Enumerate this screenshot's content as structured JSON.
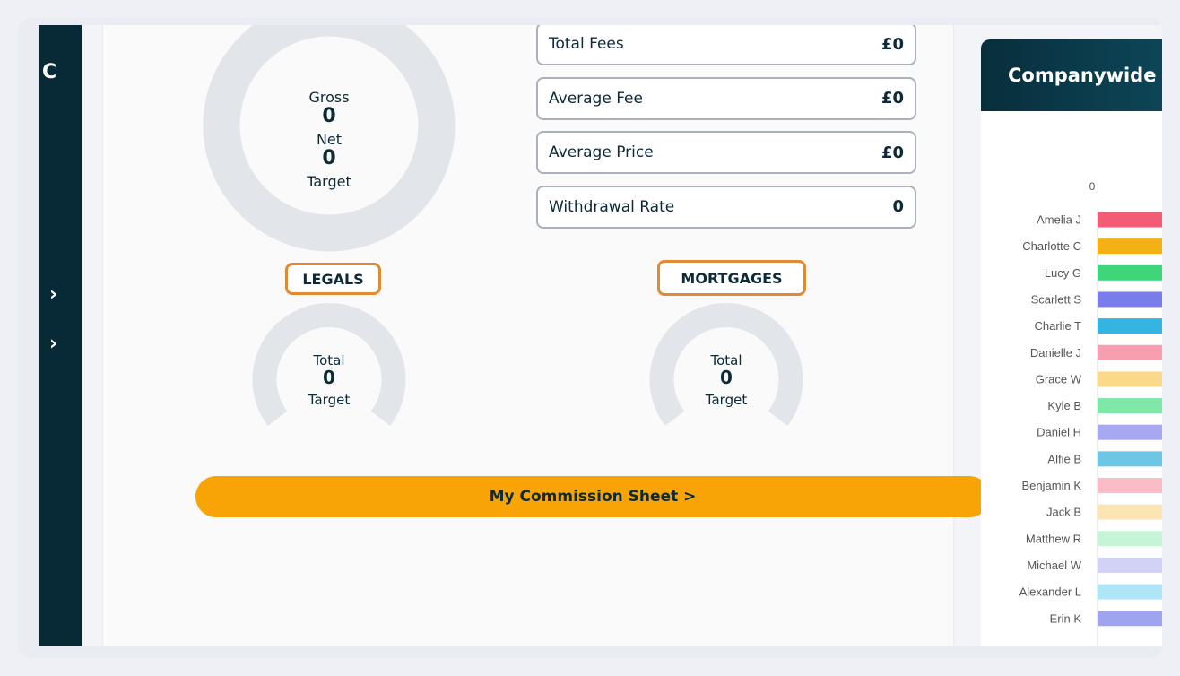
{
  "sidebar": {
    "letter": "C",
    "chevron_1": "›",
    "chevron_2": "›"
  },
  "sales": {
    "gross_label": "Gross",
    "gross_value": "0",
    "net_label": "Net",
    "net_value": "0",
    "target_label": "Target"
  },
  "stats": [
    {
      "label": "Total Fees",
      "value": "£0"
    },
    {
      "label": "Average Fee",
      "value": "£0"
    },
    {
      "label": "Average Price",
      "value": "£0"
    },
    {
      "label": "Withdrawal Rate",
      "value": "0"
    }
  ],
  "legals": {
    "title": "LEGALS",
    "total_label": "Total",
    "total_value": "0",
    "target_label": "Target"
  },
  "mortgages": {
    "title": "MORTGAGES",
    "total_label": "Total",
    "total_value": "0",
    "target_label": "Target"
  },
  "commission_button": "My Commission Sheet >",
  "companywide": {
    "title": "Companywide"
  },
  "chart_data": {
    "type": "bar",
    "orientation": "horizontal",
    "x_tick_labels": [
      "0"
    ],
    "categories": [
      "Amelia J",
      "Charlotte C",
      "Lucy G",
      "Scarlett S",
      "Charlie T",
      "Danielle J",
      "Grace W",
      "Kyle B",
      "Daniel H",
      "Alfie B",
      "Benjamin K",
      "Jack B",
      "Matthew R",
      "Michael W",
      "Alexander L",
      "Erin K"
    ],
    "colors": [
      "#f25c74",
      "#f5b014",
      "#3fd57a",
      "#7b7cec",
      "#34b4e0",
      "#f79eb0",
      "#fbd98a",
      "#7fe8a8",
      "#a8a8f0",
      "#6cc6e6",
      "#fbbcc8",
      "#fde4b4",
      "#c6f4d6",
      "#d2d2f6",
      "#aee6f6",
      "#a0a4ee"
    ]
  }
}
